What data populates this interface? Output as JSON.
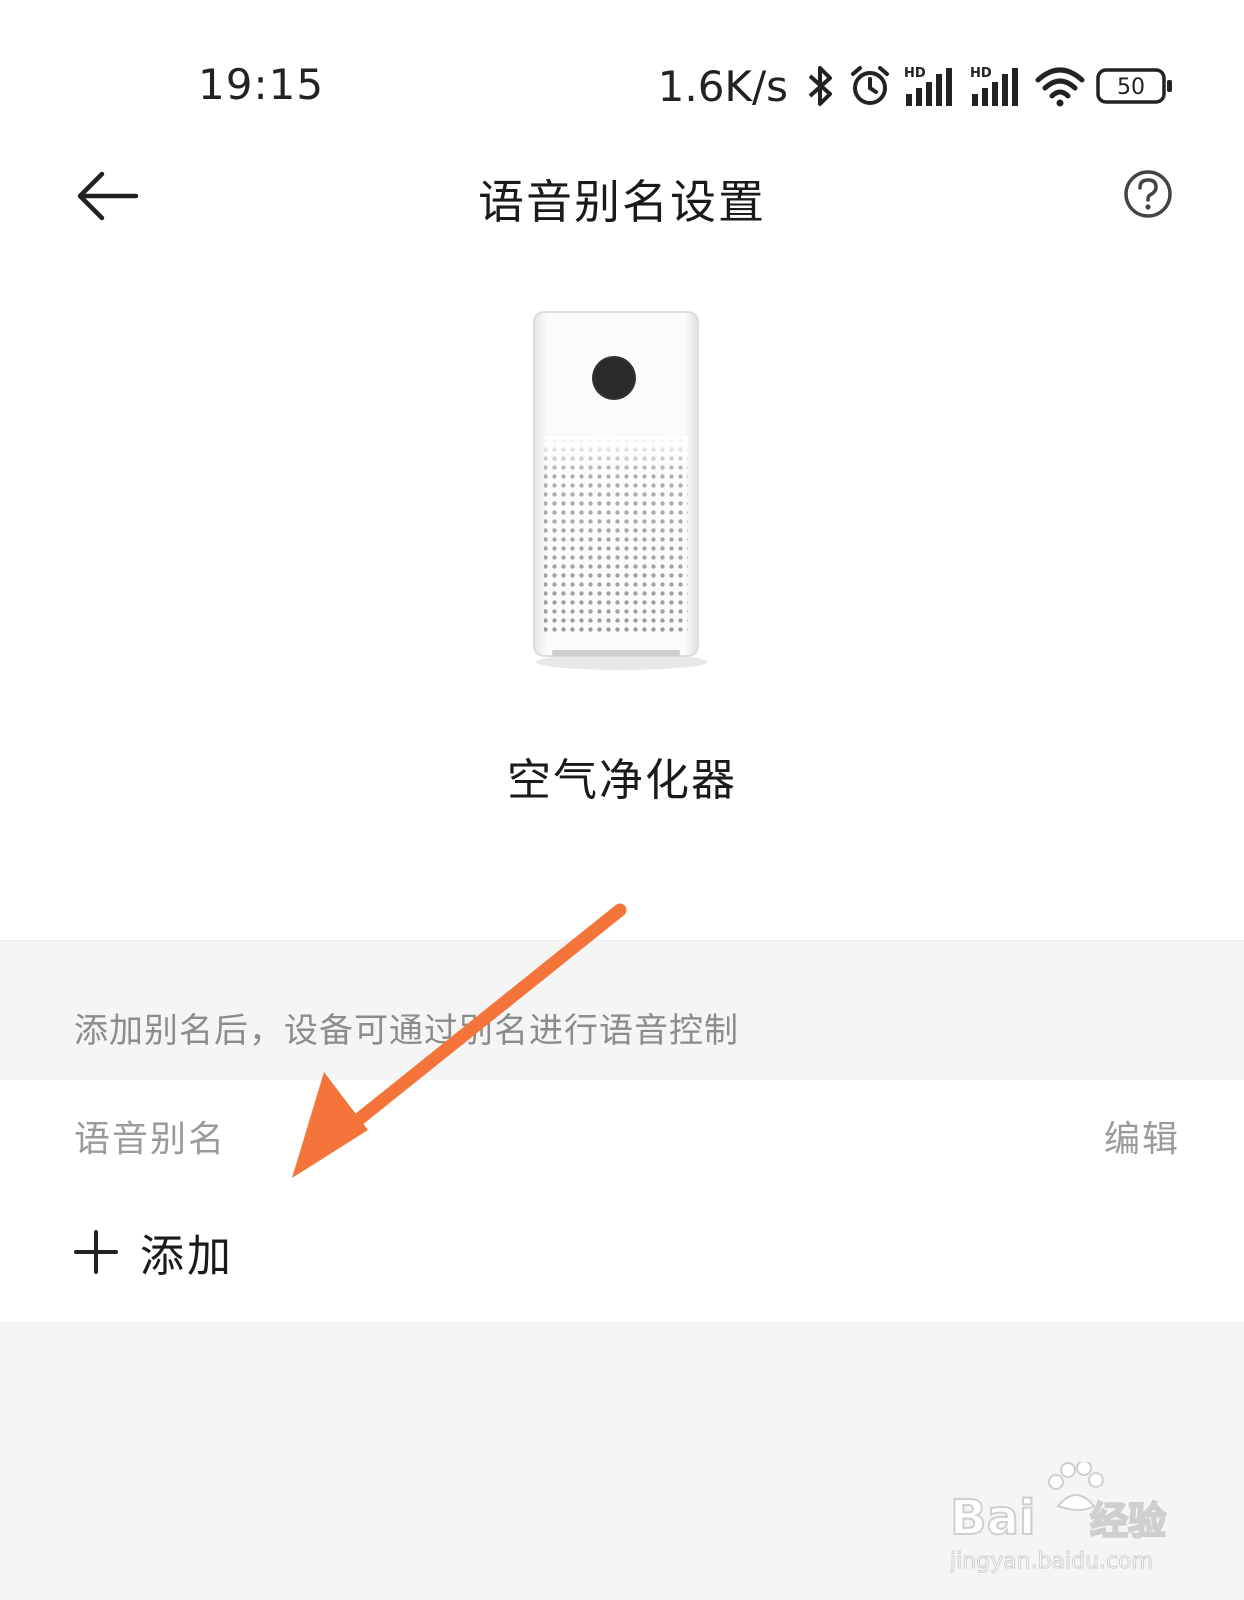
{
  "status_bar": {
    "time": "19:15",
    "net_speed": "1.6K/s",
    "battery": "50",
    "icons": [
      "bluetooth-icon",
      "alarm-icon",
      "hd-signal-icon",
      "hd-signal-icon",
      "wifi-icon",
      "battery-icon"
    ]
  },
  "header": {
    "title": "语音别名设置",
    "back_icon": "back-arrow-icon",
    "help_icon": "help-circle-icon"
  },
  "device": {
    "name": "空气净化器"
  },
  "info": {
    "text": "添加别名后，设备可通过别名进行语音控制"
  },
  "alias": {
    "label": "语音别名",
    "edit_label": "编辑",
    "add_label": "添加"
  },
  "colors": {
    "annotation_arrow": "#f5743a",
    "band_bg": "#f5f5f5"
  },
  "watermark": {
    "brand": "Bai",
    "brand_suffix": "经验",
    "url": "jingyan.baidu.com"
  }
}
